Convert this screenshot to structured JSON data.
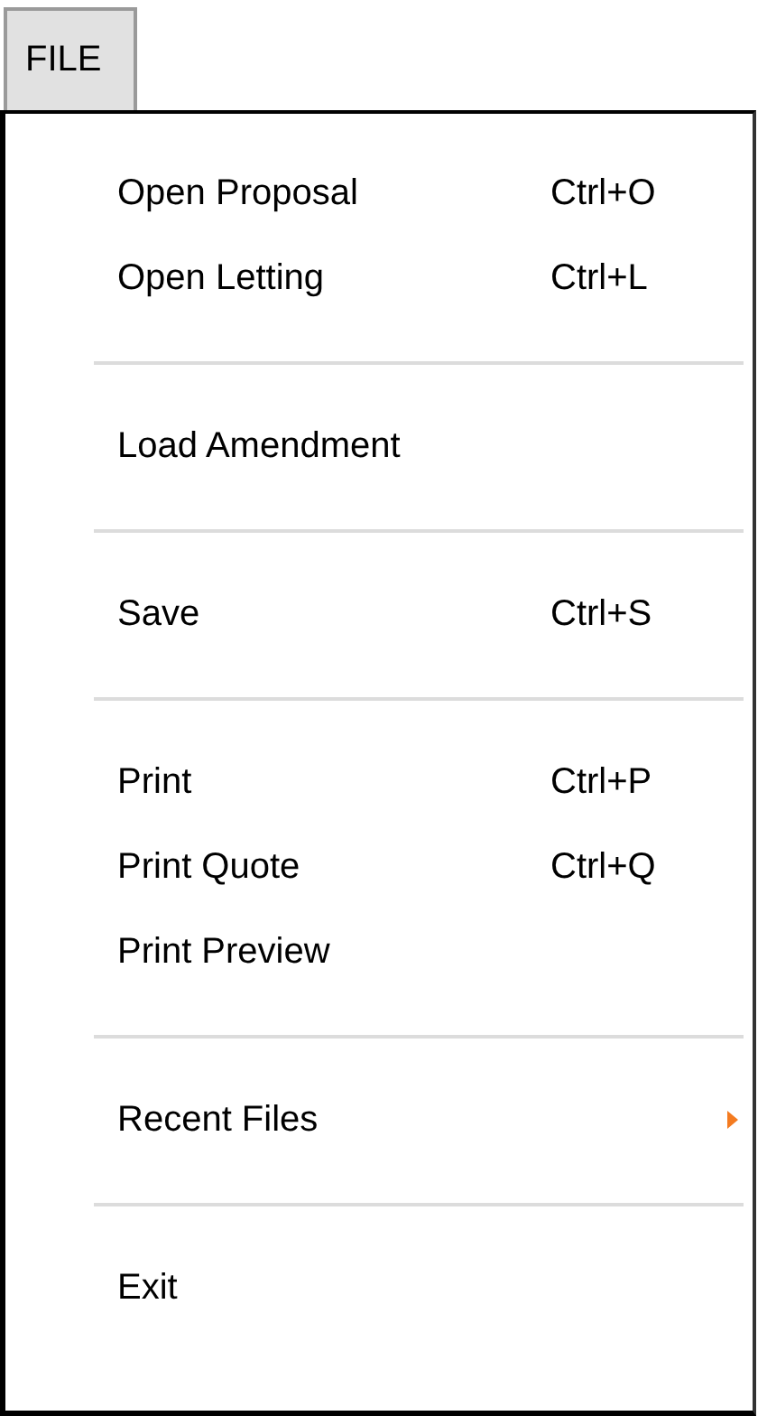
{
  "menu_button": {
    "label": "FILE"
  },
  "menu": [
    {
      "kind": "item",
      "label": "Open Proposal",
      "shortcut": "Ctrl+O"
    },
    {
      "kind": "item",
      "label": "Open Letting",
      "shortcut": "Ctrl+L"
    },
    {
      "kind": "separator"
    },
    {
      "kind": "item",
      "label": "Load Amendment"
    },
    {
      "kind": "separator"
    },
    {
      "kind": "item",
      "label": "Save",
      "shortcut": "Ctrl+S"
    },
    {
      "kind": "separator"
    },
    {
      "kind": "item",
      "label": "Print",
      "shortcut": "Ctrl+P"
    },
    {
      "kind": "item",
      "label": "Print Quote",
      "shortcut": "Ctrl+Q"
    },
    {
      "kind": "item",
      "label": "Print Preview"
    },
    {
      "kind": "separator"
    },
    {
      "kind": "submenu",
      "label": "Recent Files"
    },
    {
      "kind": "separator"
    },
    {
      "kind": "item",
      "label": "Exit"
    }
  ]
}
